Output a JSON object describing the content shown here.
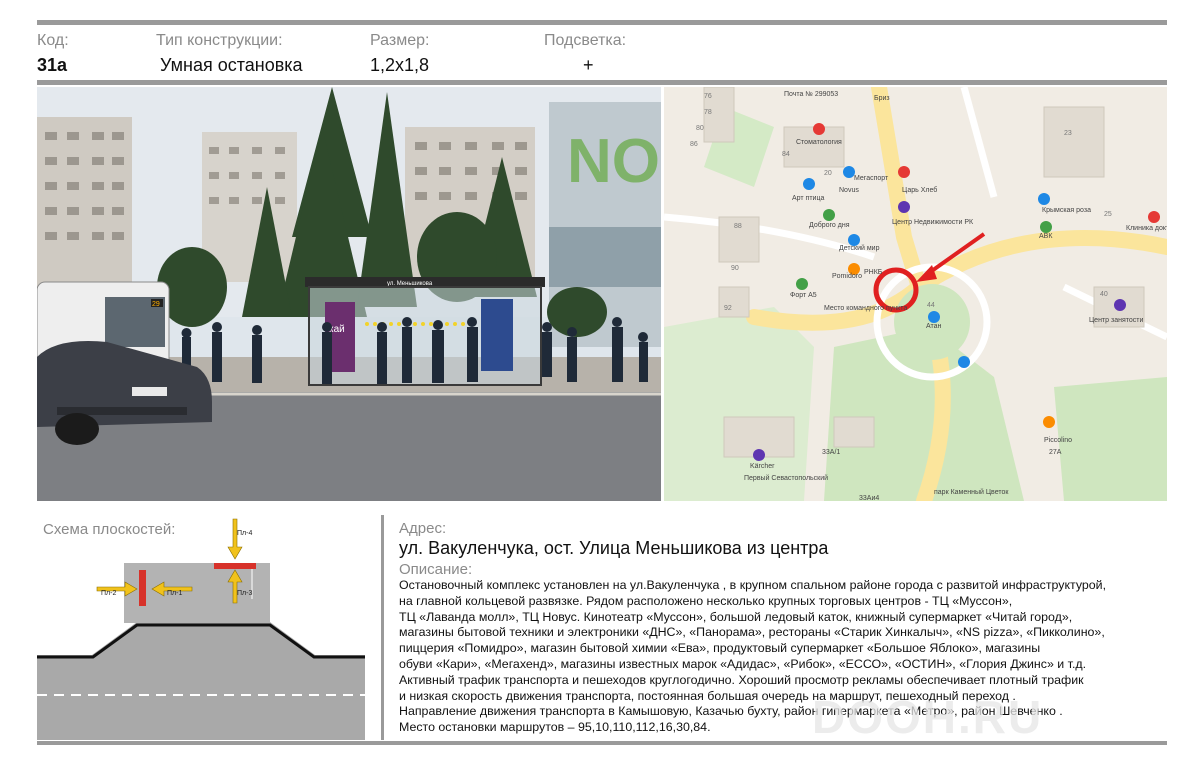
{
  "header": {
    "code_label": "Код:",
    "code_value": "31а",
    "type_label": "Тип конструкции:",
    "type_value": "Умная остановка",
    "size_label": "Размер:",
    "size_value": "1,2х1,8",
    "light_label": "Подсветка:",
    "light_value": "+"
  },
  "photo": {
    "store_sign": "NO",
    "shelter_sign": "ул. Меньшикова",
    "bus_number": "29",
    "ad_text": "кай"
  },
  "map": {
    "labels": [
      "Почта № 299053",
      "Бриз",
      "Стоматология",
      "Мегаспорт",
      "Novus",
      "Арт птица",
      "Царь Хлеб",
      "Доброго дня",
      "Центр Недвижимости РК",
      "Детский мир",
      "РНКБ",
      "Pomidoro",
      "Форт А5",
      "Место командного пункта",
      "Атан",
      "Крымская роза",
      "АВК",
      "Клиника доктора Воробьёва",
      "Центр занятости",
      "Piccolino",
      "27А",
      "33А/1",
      "Kärcher",
      "Первый Севастопольский",
      "33Аи4",
      "парк Каменный Цветок"
    ],
    "house_numbers": [
      "76",
      "78",
      "80",
      "86",
      "84",
      "20",
      "88",
      "90",
      "92",
      "44",
      "23",
      "25",
      "40"
    ],
    "colors": {
      "pin_red": "#e53935",
      "pin_green": "#43a047",
      "pin_blue": "#1e88e5",
      "pin_orange": "#fb8c00",
      "pin_purple": "#5e35b1",
      "marker": "#e02020"
    }
  },
  "scheme": {
    "label": "Схема плоскостей:",
    "planes": [
      "Пл-1",
      "Пл-2",
      "Пл-3",
      "Пл-4"
    ]
  },
  "address": {
    "label": "Адрес:",
    "value": "ул. Вакуленчука, ост. Улица Меньшикова из центра"
  },
  "description": {
    "label": "Описание:",
    "lines": [
      "Остановочный комплекс установлен на ул.Вакуленчука , в крупном спальном районе города  с развитой инфраструктурой,",
      "на главной кольцевой развязке.    Рядом расположено несколько крупных торговых центров - ТЦ «Муссон»,",
      "ТЦ «Лаванда молл», ТЦ Новус.  Кинотеатр «Муссон»,  большой ледовый каток, книжный супермаркет «Читай город»,",
      "магазины бытовой техники и электроники «ДНС», «Панорама», рестораны «Старик Хинкалыч», «NS pizza», «Пикколино»,",
      "пиццерия «Помидро», магазин бытовой химии «Ева»,  продуктовый супермаркет «Большое Яблоко», магазины",
      "обуви «Кари», «Мегахенд»,  магазины известных марок «Адидас», «Рибок», «ЕССО», «ОСТИН», «Глория Джинс» и т.д.",
      "Активный трафик транспорта и пешеходов круглогодично. Хороший  просмотр рекламы обеспечивает плотный трафик",
      "и низкая скорость движения транспорта, постоянная большая очередь на маршрут, пешеходный переход .",
      "Направление движения транспорта в Камышовую, Казачью бухту, район гипермаркета «Метро», район Шевченко .",
      "Место остановки маршрутов – 95,10,110,112,16,30,84."
    ]
  },
  "watermark": "DOOH.RU"
}
